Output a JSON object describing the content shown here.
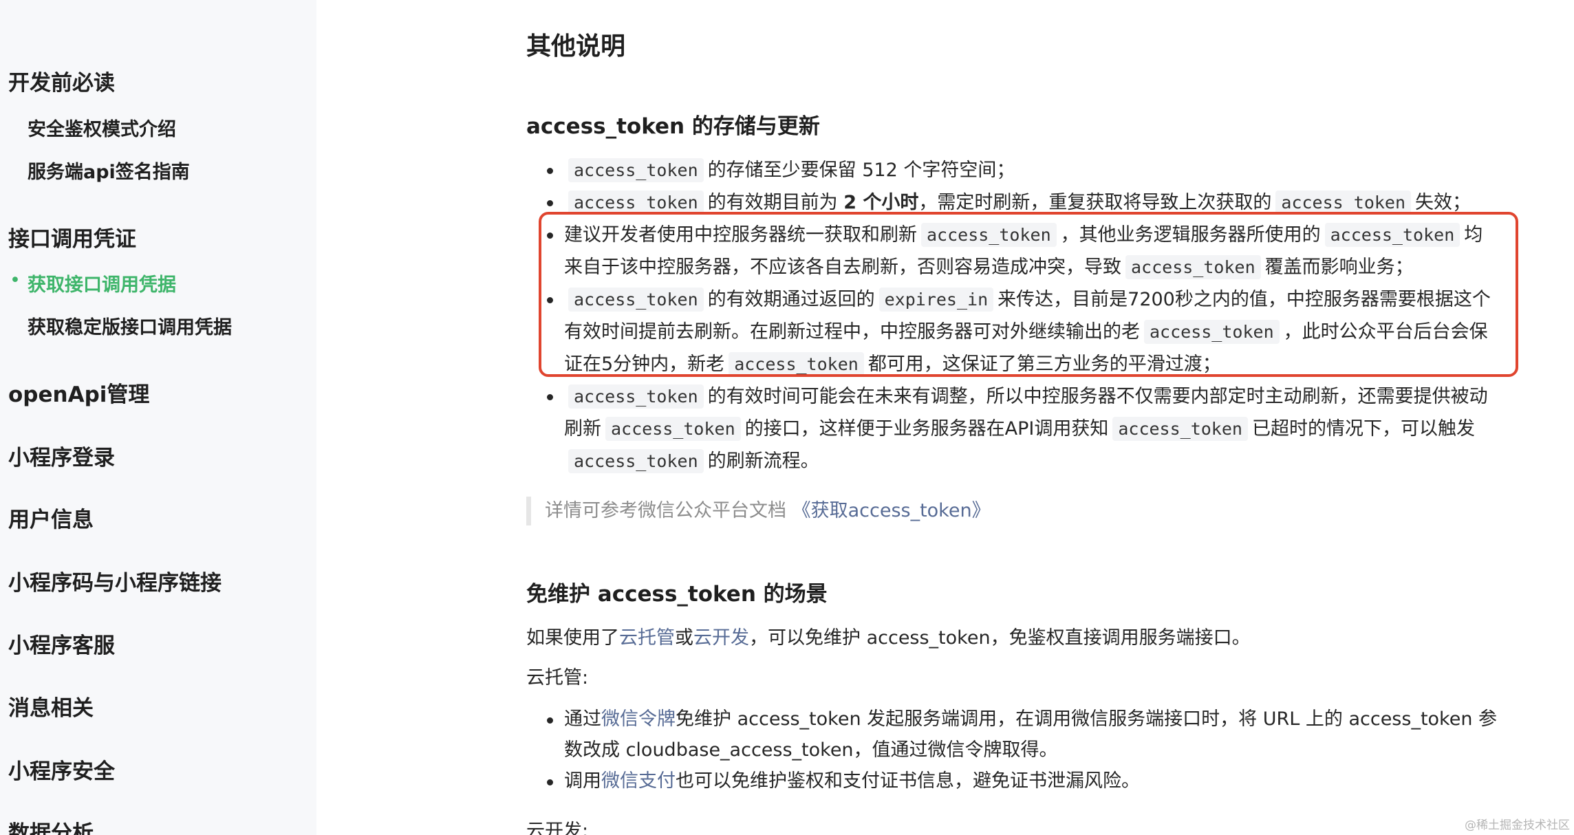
{
  "sidebar": {
    "sections": [
      {
        "title": "开发前必读",
        "items": [
          "安全鉴权模式介绍",
          "服务端api签名指南"
        ]
      },
      {
        "title": "接口调用凭证",
        "items": [
          "获取接口调用凭据",
          "获取稳定版接口调用凭据"
        ],
        "active_item": "获取接口调用凭据"
      },
      {
        "title": "openApi管理"
      },
      {
        "title": "小程序登录"
      },
      {
        "title": "用户信息"
      },
      {
        "title": "小程序码与小程序链接"
      },
      {
        "title": "小程序客服"
      },
      {
        "title": "消息相关"
      },
      {
        "title": "小程序安全"
      },
      {
        "title": "数据分析"
      }
    ],
    "active_dot": "•"
  },
  "main": {
    "title": "其他说明",
    "storage": {
      "heading": "access_token 的存储与更新",
      "code_token": "access_token",
      "code_expires": "expires_in",
      "b1_text": "的存储至少要保留 512 个字符空间；",
      "b2_text1": "的有效期目前为",
      "b2_bold": "2 个小时",
      "b2_text2": "，需定时刷新，重复获取将导致上次获取的",
      "b2_text3": "失效；",
      "b3_l1_text1": "建议开发者使用中控服务器统一获取和刷新",
      "b3_l1_text2": "，其他业务逻辑服务器所使用的",
      "b3_l1_text3": "均",
      "b3_l2_text1": "来自于该中控服务器，不应该各自去刷新，否则容易造成冲突，导致",
      "b3_l2_text2": "覆盖而影响业务；",
      "b4_l1_text1": "的有效期通过返回的",
      "b4_l1_text2": "来传达，目前是7200秒之内的值，中控服务器需要根据这个",
      "b4_l2_text1": "有效时间提前去刷新。在刷新过程中，中控服务器可对外继续输出的老",
      "b4_l2_text2": "，此时公众平台后台会保",
      "b4_l3_text1": "证在5分钟内，新老",
      "b4_l3_text2": "都可用，这保证了第三方业务的平滑过渡；",
      "b5_l1_text1": "的有效时间可能会在未来有调整，所以中控服务器不仅需要内部定时主动刷新，还需要提供被动",
      "b5_l2_text1": "刷新",
      "b5_l2_text2": "的接口，这样便于业务服务器在API调用获知",
      "b5_l2_text3": "已超时的情况下，可以触发",
      "b5_l3_text1": "的刷新流程。",
      "quote_text": "详情可参考微信公众平台文档",
      "quote_link": "《获取access_token》"
    },
    "free": {
      "heading": "免维护 access_token 的场景",
      "p1_text1": "如果使用了",
      "p1_link1": "云托管",
      "p1_text2": "或",
      "p1_link2": "云开发",
      "p1_text3": "，可以免维护 access_token，免鉴权直接调用服务端接口。",
      "cloudrun_label": "云托管:",
      "c1_l1_text1": "通过",
      "c1_l1_link": "微信令牌",
      "c1_l1_text2": "免维护 access_token 发起服务端调用，在调用微信服务端接口时，将 URL 上的 access_token 参",
      "c1_l2_text": "数改成 cloudbase_access_token，值通过微信令牌取得。",
      "c2_text1": "调用",
      "c2_link": "微信支付",
      "c2_text2": "也可以免维护鉴权和支付证书信息，避免证书泄漏风险。",
      "cloudbase_label": "云开发:"
    }
  },
  "watermark": "@稀土掘金技术社区",
  "colors": {
    "highlight_border": "#e0452f",
    "link": "#576b95",
    "active": "#3eb56a"
  }
}
